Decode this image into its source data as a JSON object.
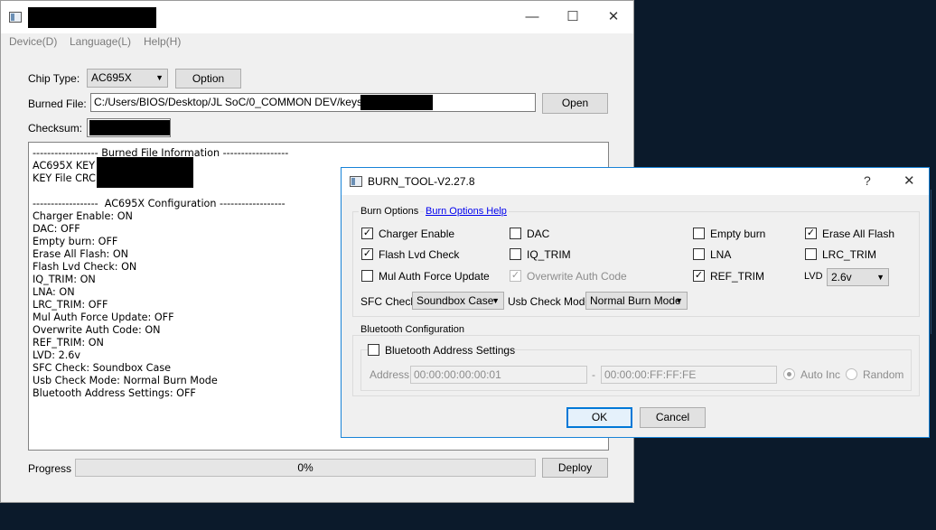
{
  "main": {
    "menu": [
      "Device(D)",
      "Language(L)",
      "Help(H)"
    ],
    "chip_type_label": "Chip Type:",
    "chip_type_value": "AC695X",
    "option_button": "Option",
    "burned_file_label": "Burned File:",
    "burned_file_value": "C:/Users/BIOS/Desktop/JL SoC/0_COMMON DEV/keys/",
    "open_button": "Open",
    "checksum_label": "Checksum:",
    "info_lines": [
      "------------------ Burned File Information ------------------",
      "AC695X KEY",
      "KEY File CRC:",
      "",
      "------------------  AC695X Configuration ------------------",
      "Charger Enable: ON",
      "DAC: OFF",
      "Empty burn: OFF",
      "Erase All Flash: ON",
      "Flash Lvd Check: ON",
      "IQ_TRIM: ON",
      "LNA: ON",
      "LRC_TRIM: OFF",
      "Mul Auth Force Update: OFF",
      "Overwrite Auth Code: ON",
      "REF_TRIM: ON",
      "LVD: 2.6v",
      "SFC Check: Soundbox Case",
      "Usb Check Mode: Normal Burn Mode",
      "Bluetooth Address Settings: OFF"
    ],
    "progress_label": "Progress",
    "progress_text": "0%",
    "progress_value": 0,
    "deploy_button": "Deploy"
  },
  "dialog": {
    "title": "BURN_TOOL-V2.27.8",
    "help_glyph": "?",
    "burn_options_title": "Burn Options",
    "burn_options_help": "Burn Options Help",
    "checkboxes": {
      "charger_enable": {
        "label": "Charger Enable",
        "checked": true
      },
      "dac": {
        "label": "DAC",
        "checked": false
      },
      "empty_burn": {
        "label": "Empty burn",
        "checked": false
      },
      "erase_all_flash": {
        "label": "Erase All Flash",
        "checked": true
      },
      "flash_lvd_check": {
        "label": "Flash Lvd Check",
        "checked": true
      },
      "iq_trim": {
        "label": "IQ_TRIM",
        "checked": false
      },
      "lna": {
        "label": "LNA",
        "checked": false
      },
      "lrc_trim": {
        "label": "LRC_TRIM",
        "checked": false
      },
      "mul_auth_force_update": {
        "label": "Mul Auth Force Update",
        "checked": false
      },
      "overwrite_auth_code": {
        "label": "Overwrite Auth Code",
        "checked": true,
        "disabled": true
      },
      "ref_trim": {
        "label": "REF_TRIM",
        "checked": true
      }
    },
    "lvd_label": "LVD",
    "lvd_value": "2.6v",
    "sfc_check_label": "SFC Check",
    "sfc_check_value": "Soundbox Case",
    "usb_check_mode_label": "Usb Check Mode",
    "usb_check_mode_value": "Normal Burn Mode",
    "bluetooth_title": "Bluetooth Configuration",
    "bluetooth_address_settings": {
      "label": "Bluetooth Address Settings",
      "checked": false
    },
    "address_label": "Address",
    "address_start": "00:00:00:00:00:01",
    "address_sep": "-",
    "address_end": "00:00:00:FF:FF:FE",
    "auto_inc_label": "Auto Inc",
    "random_label": "Random",
    "ok_button": "OK",
    "cancel_button": "Cancel"
  }
}
